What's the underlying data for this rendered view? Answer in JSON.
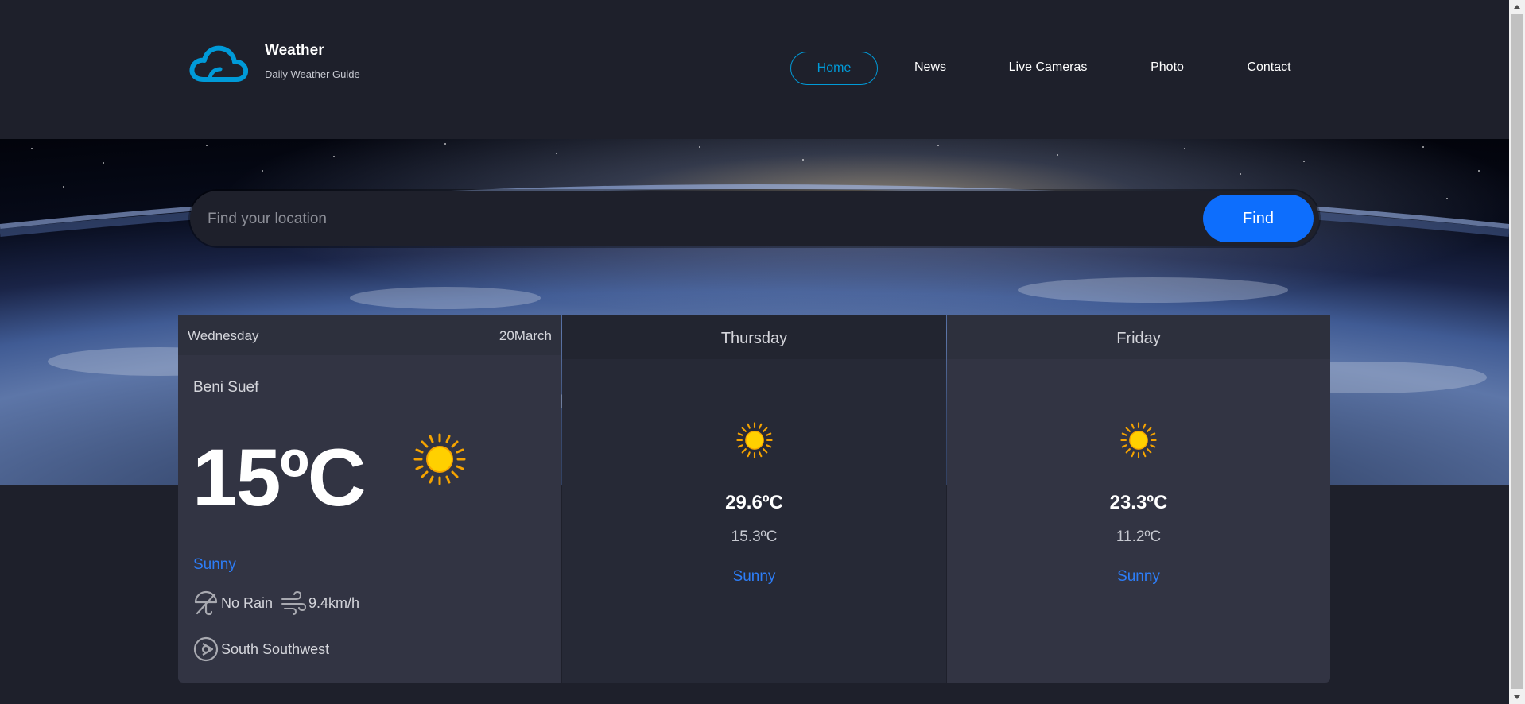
{
  "header": {
    "title": "Weather",
    "subtitle": "Daily Weather Guide",
    "logo_icon": "cloud-icon",
    "accent": "#009ad8"
  },
  "nav": {
    "items": [
      {
        "label": "Home",
        "active": true
      },
      {
        "label": "News",
        "active": false
      },
      {
        "label": "Live Cameras",
        "active": false
      },
      {
        "label": "Photo",
        "active": false
      },
      {
        "label": "Contact",
        "active": false
      }
    ]
  },
  "search": {
    "placeholder": "Find your location",
    "value": "",
    "button_label": "Find",
    "button_color": "#0d6efd"
  },
  "forecast": {
    "today": {
      "day": "Wednesday",
      "date": "20March",
      "city": "Beni Suef",
      "temp": "15ºC",
      "icon": "sun-icon",
      "condition": "Sunny",
      "rain": "No Rain",
      "wind_speed": "9.4km/h",
      "wind_direction": "South Southwest"
    },
    "days": [
      {
        "day": "Thursday",
        "icon": "sun-icon",
        "max": "29.6ºC",
        "min": "15.3ºC",
        "condition": "Sunny"
      },
      {
        "day": "Friday",
        "icon": "sun-icon",
        "max": "23.3ºC",
        "min": "11.2ºC",
        "condition": "Sunny"
      }
    ],
    "condition_color": "#2d7df7"
  }
}
